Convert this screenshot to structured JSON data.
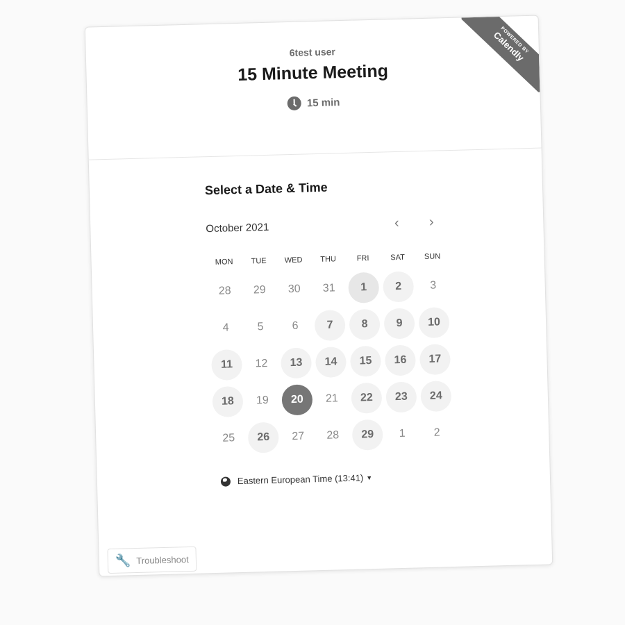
{
  "ribbon": {
    "powered_by": "POWERED BY",
    "brand": "Calendly"
  },
  "header": {
    "host": "6test user",
    "title": "15 Minute Meeting",
    "duration": "15 min"
  },
  "picker": {
    "title": "Select a Date & Time",
    "month": "October 2021",
    "prev_icon": "‹",
    "next_icon": "›",
    "weekdays": [
      "MON",
      "TUE",
      "WED",
      "THU",
      "FRI",
      "SAT",
      "SUN"
    ],
    "days": [
      {
        "label": "28",
        "state": "disabled"
      },
      {
        "label": "29",
        "state": "disabled"
      },
      {
        "label": "30",
        "state": "disabled"
      },
      {
        "label": "31",
        "state": "disabled"
      },
      {
        "label": "1",
        "state": "today"
      },
      {
        "label": "2",
        "state": "available"
      },
      {
        "label": "3",
        "state": "disabled"
      },
      {
        "label": "4",
        "state": "disabled"
      },
      {
        "label": "5",
        "state": "disabled"
      },
      {
        "label": "6",
        "state": "disabled"
      },
      {
        "label": "7",
        "state": "available"
      },
      {
        "label": "8",
        "state": "available"
      },
      {
        "label": "9",
        "state": "available"
      },
      {
        "label": "10",
        "state": "available"
      },
      {
        "label": "11",
        "state": "available"
      },
      {
        "label": "12",
        "state": "disabled"
      },
      {
        "label": "13",
        "state": "available"
      },
      {
        "label": "14",
        "state": "available"
      },
      {
        "label": "15",
        "state": "available"
      },
      {
        "label": "16",
        "state": "available"
      },
      {
        "label": "17",
        "state": "available"
      },
      {
        "label": "18",
        "state": "available"
      },
      {
        "label": "19",
        "state": "disabled"
      },
      {
        "label": "20",
        "state": "selected"
      },
      {
        "label": "21",
        "state": "disabled"
      },
      {
        "label": "22",
        "state": "available"
      },
      {
        "label": "23",
        "state": "available"
      },
      {
        "label": "24",
        "state": "available"
      },
      {
        "label": "25",
        "state": "disabled"
      },
      {
        "label": "26",
        "state": "available"
      },
      {
        "label": "27",
        "state": "disabled"
      },
      {
        "label": "28",
        "state": "disabled"
      },
      {
        "label": "29",
        "state": "available"
      },
      {
        "label": "1",
        "state": "disabled"
      },
      {
        "label": "2",
        "state": "disabled"
      }
    ],
    "timezone": "Eastern European Time (13:41)"
  },
  "troubleshoot": {
    "label": "Troubleshoot"
  },
  "colors": {
    "selected": "#767676",
    "available_bg": "#f2f2f2",
    "ribbon": "#6b6b6b"
  }
}
